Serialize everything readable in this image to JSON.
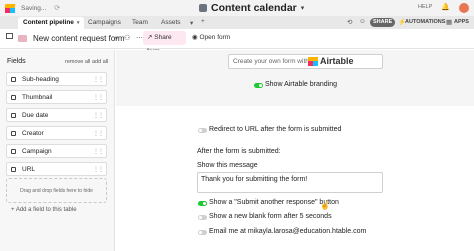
{
  "topbar": {
    "saving": "Saving...",
    "title": "Content calendar",
    "help": "HELP"
  },
  "tabs": [
    {
      "label": "Content pipeline"
    },
    {
      "label": "Campaigns"
    },
    {
      "label": "Team"
    },
    {
      "label": "Assets"
    }
  ],
  "tabbar_right": {
    "share": "SHARE",
    "automations": "AUTOMATIONS",
    "apps": "APPS"
  },
  "formbar": {
    "form_name": "New content request form",
    "share_form": "Share form",
    "open_form": "Open form"
  },
  "fields_panel": {
    "heading": "Fields",
    "remove_all": "remove all",
    "add_all": "add all",
    "items": [
      {
        "label": "Sub-heading"
      },
      {
        "label": "Thumbnail"
      },
      {
        "label": "Due date"
      },
      {
        "label": "Creator"
      },
      {
        "label": "Campaign"
      },
      {
        "label": "URL"
      }
    ],
    "drop_hint": "Drag and drop fields here to hide",
    "add_field": "+ Add a field to this table"
  },
  "branding": {
    "create_text": "Create your own form with",
    "brand_name": "Airtable",
    "show_branding": "Show Airtable branding"
  },
  "options": {
    "redirect": "Redirect to URL after the form is submitted",
    "after_submitted": "After the form is submitted:",
    "show_message": "Show this message",
    "message": "Thank you for submitting the form!",
    "show_another": "Show a \"Submit another response\" button",
    "show_new_blank": "Show a new blank form after 5 seconds",
    "email_me": "Email me at mikayla.larosa@education.htable.com"
  },
  "colors": {
    "accent_green": "#20c933",
    "share_form_bg": "#fde7f1"
  }
}
